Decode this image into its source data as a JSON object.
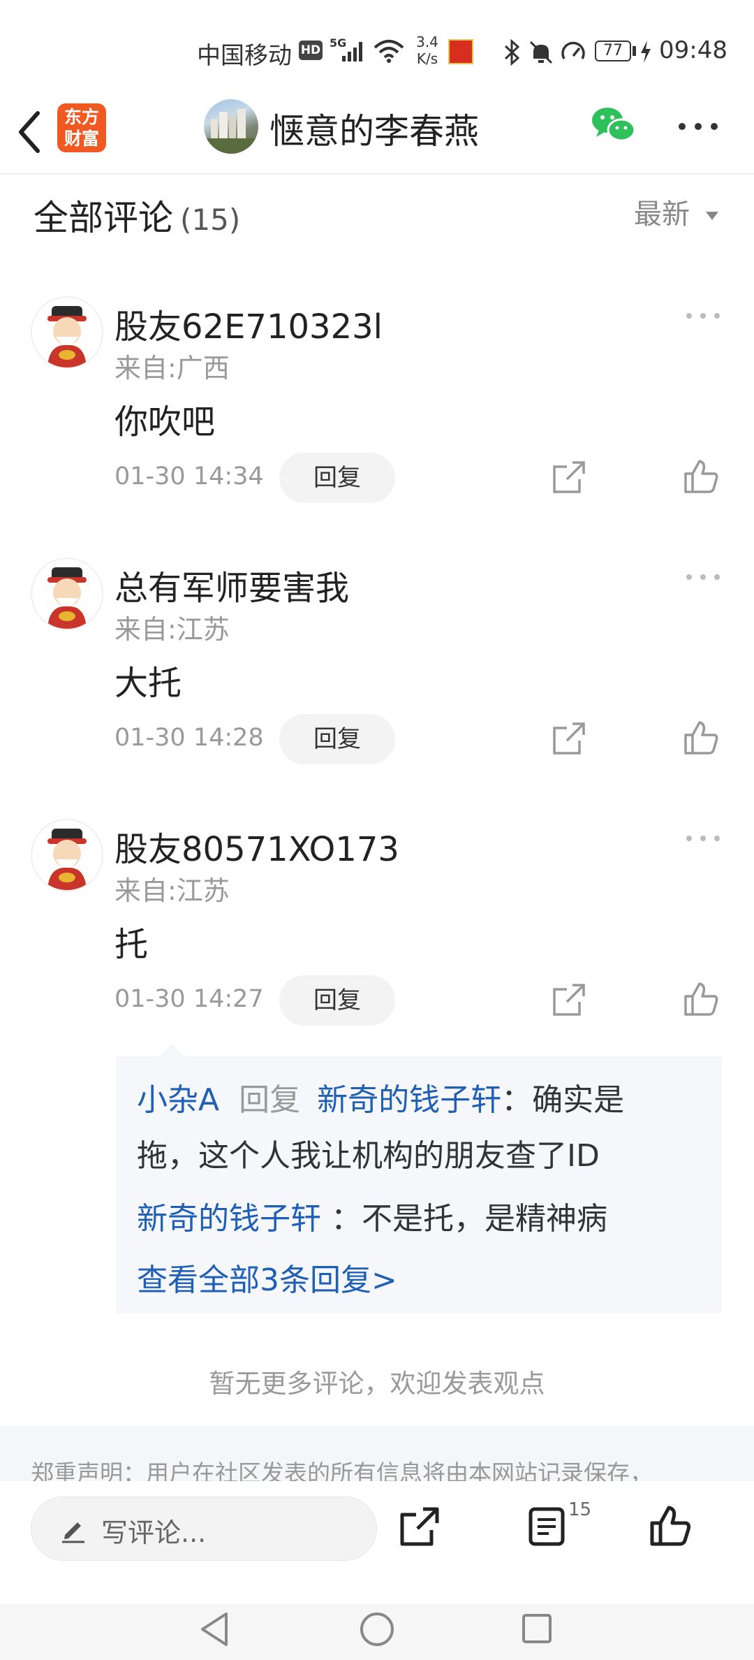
{
  "status_bar": {
    "carrier": "中国移动",
    "hd_badge": "HD",
    "network": "5G",
    "speed_value": "3.4",
    "speed_unit": "K/s",
    "battery": "77",
    "time": "09:48",
    "icons": [
      "signal-icon",
      "wifi-icon",
      "notification-app-icon",
      "bluetooth-icon",
      "mute-icon",
      "speedometer-icon",
      "battery-icon",
      "charging-icon"
    ]
  },
  "header": {
    "logo_line1": "东方",
    "logo_line2": "财富",
    "title": "惬意的李春燕"
  },
  "comments_header": {
    "title": "全部评论",
    "count": "(15)",
    "sort_label": "最新"
  },
  "comments": [
    {
      "author": "股友62E710323l",
      "location": "来自:广西",
      "text": "你吹吧",
      "time": "01-30 14:34",
      "reply_label": "回复"
    },
    {
      "author": "总有军师要害我",
      "location": "来自:江苏",
      "text": "大托",
      "time": "01-30 14:28",
      "reply_label": "回复"
    },
    {
      "author": "股友80571XO173",
      "location": "来自:江苏",
      "text": "托",
      "time": "01-30 14:27",
      "reply_label": "回复"
    }
  ],
  "replies": {
    "r1_user": "小杂A",
    "r1_action": "回复",
    "r1_target": "新奇的钱子轩",
    "r1_text_a": "：确实是",
    "r1_text_b": "拖，这个人我让机构的朋友查了ID",
    "r2_user": "新奇的钱子轩",
    "r2_text": "：不是托，是精神病",
    "view_all": "查看全部3条回复>"
  },
  "no_more": "暂无更多评论，欢迎发表观点",
  "disclaimer": "郑重声明：用户在社区发表的所有信息将由本网站记录保存，",
  "bottom_bar": {
    "input_placeholder": "写评论...",
    "comment_count": "15"
  },
  "colors": {
    "accent_blue": "#1f5fb5",
    "brand_orange": "#f05a22",
    "wechat_green": "#2ec05a"
  }
}
